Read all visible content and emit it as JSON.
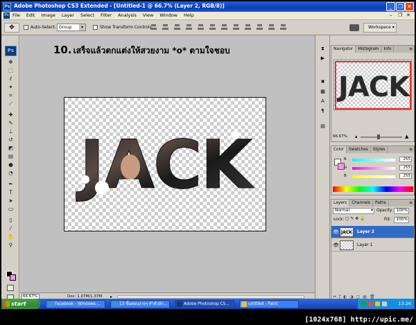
{
  "window": {
    "title": "Adobe Photoshop CS3 Extended - [Untitled-1 @ 66.7% (Layer 2, RGB/8)]",
    "app_badge": "Ps"
  },
  "menu": {
    "items": [
      "File",
      "Edit",
      "Image",
      "Layer",
      "Select",
      "Filter",
      "Analysis",
      "View",
      "Window",
      "Help"
    ]
  },
  "options": {
    "auto_select_label": "Auto-Select:",
    "auto_select_value": "Group",
    "show_transform_label": "Show Transform Controls",
    "workspace_label": "Workspace ▾"
  },
  "headline": {
    "number": "10.",
    "text": "เสร็จแล้วตกแต่งให้สวยงาม *o* ตามใจชอบ"
  },
  "canvas_text": "JACK",
  "status": {
    "zoom": "66.67%",
    "doc": "Doc: 1.07M/1.37M"
  },
  "navigator": {
    "tabs": [
      "Navigator",
      "Histogram",
      "Info"
    ],
    "zoom": "66.67%"
  },
  "color": {
    "tabs": [
      "Color",
      "Swatches",
      "Styles"
    ],
    "r_label": "R",
    "g_label": "G",
    "b_label": "B",
    "r": "255",
    "g": "255",
    "b": "255",
    "fg_color": "#ffffff",
    "bg_color": "#ff90ec"
  },
  "layers": {
    "tabs": [
      "Layers",
      "Channels",
      "Paths"
    ],
    "blend_mode": "Normal",
    "opacity_label": "Opacity:",
    "opacity": "100%",
    "lock_label": "Lock:",
    "fill_label": "Fill:",
    "fill": "100%",
    "items": [
      {
        "name": "Layer 2",
        "selected": true,
        "thumb_text": "JACK"
      },
      {
        "name": "Layer 1",
        "selected": false
      }
    ]
  },
  "taskbar": {
    "start": "start",
    "tasks": [
      "Facebook - Windows ...",
      "12 ขั้นตอนง่ายๆ ทำตัวอัก...",
      "Adobe Photoshop CS...",
      "untitled - Paint"
    ],
    "clock": "13:26"
  },
  "watermark": "[1024x768] http://upic.me/"
}
